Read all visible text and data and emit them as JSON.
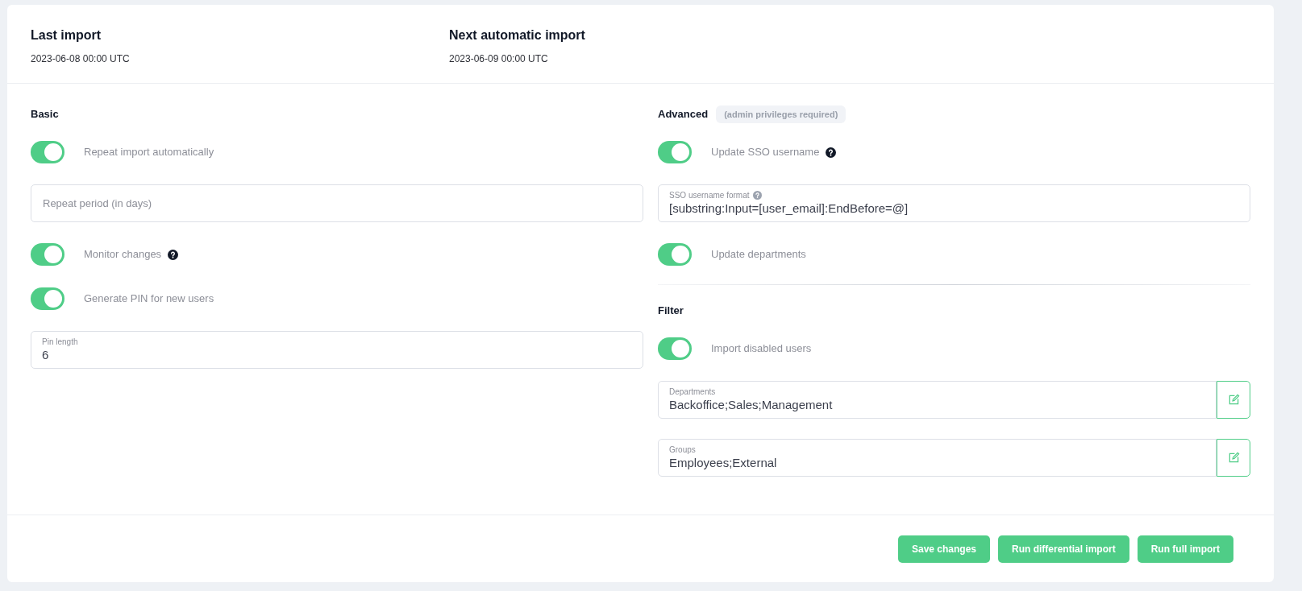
{
  "header": [
    {
      "label": "Last import",
      "value": "2023-06-08 00:00 UTC"
    },
    {
      "label": "Next automatic import",
      "value": "2023-06-09 00:00 UTC"
    }
  ],
  "basic": {
    "title": "Basic",
    "items": [
      {
        "kind": "toggle",
        "label": "Repeat import automatically",
        "on": true,
        "help": false
      },
      {
        "kind": "field",
        "placeholder": "Repeat period (in days)"
      },
      {
        "kind": "toggle",
        "label": "Monitor changes",
        "on": true,
        "help": true
      },
      {
        "kind": "toggle",
        "label": "Generate PIN for new users",
        "on": true,
        "help": false
      },
      {
        "kind": "field",
        "label": "Pin length",
        "value": "6",
        "help": false
      }
    ]
  },
  "advanced": {
    "title": "Advanced",
    "badge": "(admin privileges required)",
    "items": [
      {
        "kind": "toggle",
        "label": "Update SSO username",
        "on": true,
        "help": true
      },
      {
        "kind": "field",
        "label": "SSO username format",
        "value": "[substring:Input=[user_email]:EndBefore=@]",
        "help": true
      },
      {
        "kind": "toggle",
        "label": "Update departments",
        "on": true,
        "help": false
      }
    ]
  },
  "filter": {
    "title": "Filter",
    "items": [
      {
        "kind": "toggle",
        "label": "Import disabled users",
        "on": true,
        "help": false
      },
      {
        "kind": "picker",
        "label": "Departments",
        "value": "Backoffice;Sales;Management"
      },
      {
        "kind": "picker",
        "label": "Groups",
        "value": "Employees;External"
      }
    ]
  },
  "buttons": [
    "Save changes",
    "Run differential import",
    "Run full import"
  ]
}
